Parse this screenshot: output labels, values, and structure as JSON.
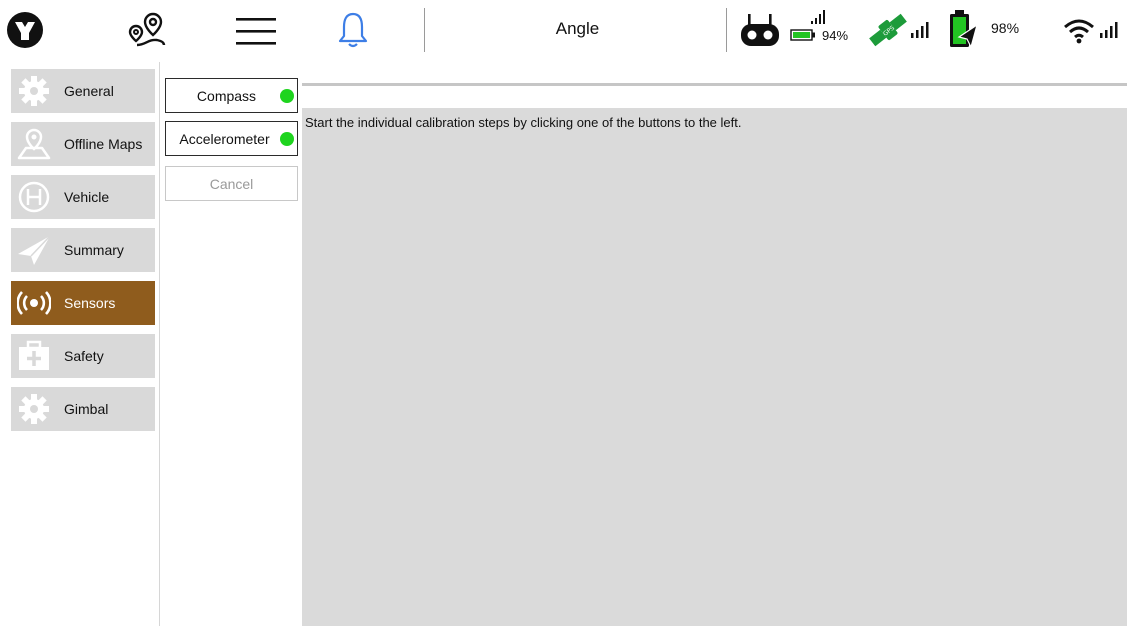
{
  "toolbar": {
    "mode": "Angle",
    "controller_battery": "94%",
    "vehicle_battery": "98%",
    "icons": {
      "logo": "app-logo-icon",
      "plan": "plan-waypoints-icon",
      "menu": "hamburger-menu-icon",
      "notifications": "bell-icon",
      "remote": "remote-controller-icon",
      "remote_signal": "signal-bars-icon",
      "remote_battery": "battery-icon",
      "gps": "gps-satellite-icon",
      "gps_signal": "signal-bars-icon",
      "vehicle_battery": "vehicle-battery-icon",
      "wifi": "wifi-icon",
      "wifi_signal": "signal-bars-icon"
    },
    "colors": {
      "bell": "#3d7ee6",
      "green": "#1d9b3a",
      "battery_fill": "#22c422"
    }
  },
  "sidebar": {
    "items": [
      {
        "label": "General",
        "icon": "gear-icon",
        "active": false
      },
      {
        "label": "Offline Maps",
        "icon": "map-pin-icon",
        "active": false
      },
      {
        "label": "Vehicle",
        "icon": "helipad-icon",
        "active": false
      },
      {
        "label": "Summary",
        "icon": "paper-plane-icon",
        "active": false
      },
      {
        "label": "Sensors",
        "icon": "sensor-waves-icon",
        "active": true
      },
      {
        "label": "Safety",
        "icon": "first-aid-kit-icon",
        "active": false
      },
      {
        "label": "Gimbal",
        "icon": "gear-icon",
        "active": false
      }
    ],
    "colors": {
      "item_bg": "#d9d9d9",
      "active_bg": "#8f5c1d"
    }
  },
  "calibration": {
    "buttons": [
      {
        "label": "Compass",
        "status": "complete"
      },
      {
        "label": "Accelerometer",
        "status": "complete"
      }
    ],
    "cancel_label": "Cancel",
    "status_color": "#1ed41e"
  },
  "content": {
    "message": "Start the individual calibration steps by clicking one of the buttons to the left."
  }
}
